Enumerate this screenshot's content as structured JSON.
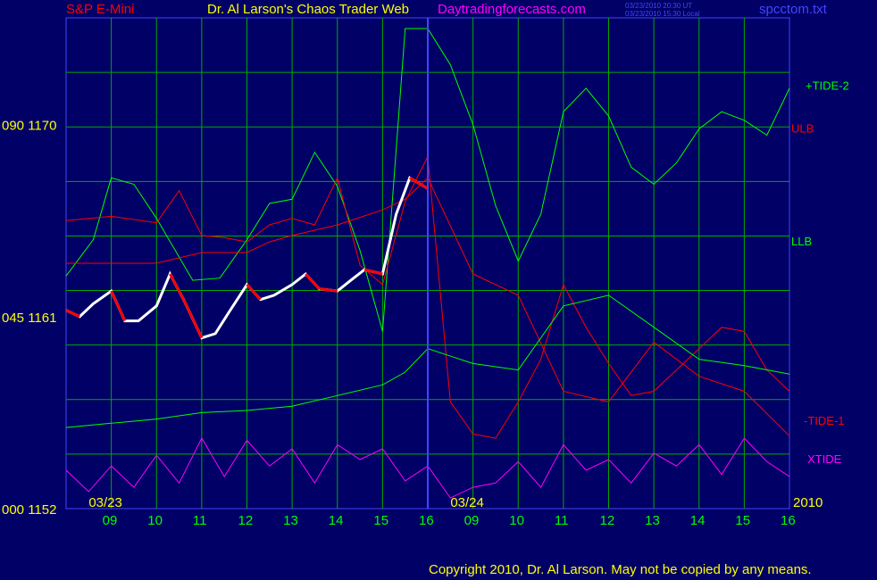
{
  "header": {
    "left_title": "S&P E-Mini",
    "center_title": "Dr. Al Larson's Chaos Trader Web",
    "site": "Daytradingforecasts.com",
    "timestamp_ut": "03/23/2010 20:30 UT",
    "timestamp_local": "03/23/2010 15:30 Local",
    "file": "spcctom.txt"
  },
  "footer": {
    "copyright": "Copyright 2010, Dr. Al Larson. May not be copied by any means."
  },
  "colors": {
    "background": "#000066",
    "grid": "#00aa00",
    "plot_border": "#4444ff",
    "tide_plus": "#00ff00",
    "tide_minus": "#ff0000",
    "xtide": "#ff00ff",
    "price_up": "#ffffff",
    "price_down": "#ff0000",
    "hours": "#00ff00",
    "labels": "#ffff00"
  },
  "chart_data": {
    "type": "line",
    "title": "S&P E-Mini",
    "y_ticks": [
      {
        "label": "090 1170",
        "value": 1170
      },
      {
        "label": "045 1161",
        "value": 1161
      },
      {
        "label": "000 1152",
        "value": 1152
      }
    ],
    "ylim": [
      1152,
      1175
    ],
    "date_labels": [
      "03/23",
      "03/24",
      "2010"
    ],
    "hour_labels": [
      "09",
      "10",
      "11",
      "12",
      "13",
      "14",
      "15",
      "16",
      "09",
      "10",
      "11",
      "12",
      "13",
      "14",
      "15",
      "16"
    ],
    "series_labels": [
      {
        "name": "+TIDE-2",
        "color": "#00ff00"
      },
      {
        "name": "ULB",
        "color": "#ff0000"
      },
      {
        "name": "LLB",
        "color": "#00ff00"
      },
      {
        "name": "-TIDE-1",
        "color": "#ff0000"
      },
      {
        "name": "XTIDE",
        "color": "#ff00ff"
      }
    ],
    "series": [
      {
        "name": "+TIDE-2",
        "x": [
          0,
          0.6,
          1,
          1.5,
          2,
          2.8,
          3.4,
          4,
          4.5,
          5,
          5.5,
          6,
          6.5,
          7,
          7.5,
          8,
          8.5,
          9,
          9.5,
          10,
          10.5,
          11,
          11.5,
          12,
          12.5,
          13,
          13.5,
          14,
          14.5,
          15,
          15.5,
          16
        ],
        "y": [
          1162.9,
          1164.6,
          1167.5,
          1167.2,
          1165.6,
          1162.7,
          1162.8,
          1164.6,
          1166.3,
          1166.5,
          1168.7,
          1167.1,
          1164.1,
          1160.3,
          1174.5,
          1174.5,
          1172.8,
          1170.0,
          1166.2,
          1163.6,
          1165.8,
          1170.6,
          1171.7,
          1170.4,
          1168.0,
          1167.2,
          1168.2,
          1169.8,
          1170.6,
          1170.2,
          1169.5,
          1171.7
        ]
      },
      {
        "name": "-TIDE-1",
        "x": [
          0,
          1,
          2,
          2.5,
          3,
          3.5,
          4,
          4.5,
          5,
          5.5,
          6,
          6.5,
          7,
          7.5,
          8,
          8.5,
          9,
          9.5,
          10,
          10.5,
          11,
          11.5,
          12,
          12.5,
          13,
          13.5,
          14,
          14.5,
          15,
          15.5,
          16
        ],
        "y": [
          1165.5,
          1165.7,
          1165.4,
          1166.9,
          1164.8,
          1164.7,
          1164.5,
          1165.3,
          1165.6,
          1165.3,
          1167.5,
          1163.4,
          1162.5,
          1166.4,
          1168.5,
          1157.0,
          1155.5,
          1155.3,
          1157.0,
          1159.0,
          1162.5,
          1160.5,
          1158.8,
          1157.3,
          1157.5,
          1158.5,
          1159.5,
          1160.5,
          1160.3,
          1158.5,
          1157.5
        ]
      },
      {
        "name": "ULB",
        "x": [
          0,
          1,
          2,
          3,
          4,
          4.5,
          5,
          6,
          7,
          7.5,
          8,
          9,
          10,
          11,
          12,
          13,
          14,
          15,
          16
        ],
        "y": [
          1163.5,
          1163.5,
          1163.5,
          1164.0,
          1164.0,
          1164.5,
          1164.8,
          1165.3,
          1166.0,
          1166.5,
          1167.5,
          1163.0,
          1162.0,
          1157.5,
          1157.0,
          1159.8,
          1158.2,
          1157.5,
          1155.4
        ]
      },
      {
        "name": "LLB",
        "x": [
          0,
          1,
          2,
          3,
          4,
          5,
          6,
          7,
          7.5,
          8,
          9,
          10,
          11,
          12,
          13,
          14,
          15,
          16
        ],
        "y": [
          1155.8,
          1156.0,
          1156.2,
          1156.5,
          1156.6,
          1156.8,
          1157.3,
          1157.8,
          1158.4,
          1159.5,
          1158.8,
          1158.5,
          1161.5,
          1162.0,
          1160.5,
          1159.0,
          1158.7,
          1158.3
        ]
      },
      {
        "name": "XTIDE",
        "x": [
          0,
          0.5,
          1,
          1.5,
          2,
          2.5,
          3,
          3.5,
          4,
          4.5,
          5,
          5.5,
          6,
          6.5,
          7,
          7.5,
          8,
          8.5,
          9,
          9.5,
          10,
          10.5,
          11,
          11.5,
          12,
          12.5,
          13,
          13.5,
          14,
          14.5,
          15,
          15.5,
          16
        ],
        "y": [
          1153.8,
          1152.8,
          1154.0,
          1153.0,
          1154.5,
          1153.2,
          1155.3,
          1153.5,
          1155.2,
          1154.0,
          1154.8,
          1153.2,
          1155.0,
          1154.3,
          1154.8,
          1153.3,
          1154.0,
          1152.5,
          1153.0,
          1153.2,
          1154.2,
          1153.0,
          1155.0,
          1153.8,
          1154.3,
          1153.2,
          1154.6,
          1154.0,
          1155.0,
          1153.6,
          1155.3,
          1154.2,
          1153.5
        ]
      },
      {
        "name": "Price",
        "x": [
          0,
          0.3,
          0.6,
          1,
          1.3,
          1.6,
          2,
          2.3,
          2.6,
          3,
          3.3,
          3.6,
          4,
          4.3,
          4.6,
          5,
          5.3,
          5.6,
          6,
          6.3,
          6.6,
          7,
          7.3,
          7.6,
          8
        ],
        "y": [
          1161.3,
          1161.0,
          1161.6,
          1162.2,
          1160.8,
          1160.8,
          1161.5,
          1163.0,
          1161.8,
          1160.0,
          1160.2,
          1161.2,
          1162.5,
          1161.8,
          1162.0,
          1162.5,
          1163.0,
          1162.3,
          1162.2,
          1162.7,
          1163.2,
          1163.0,
          1165.8,
          1167.5,
          1167.0
        ]
      }
    ]
  }
}
